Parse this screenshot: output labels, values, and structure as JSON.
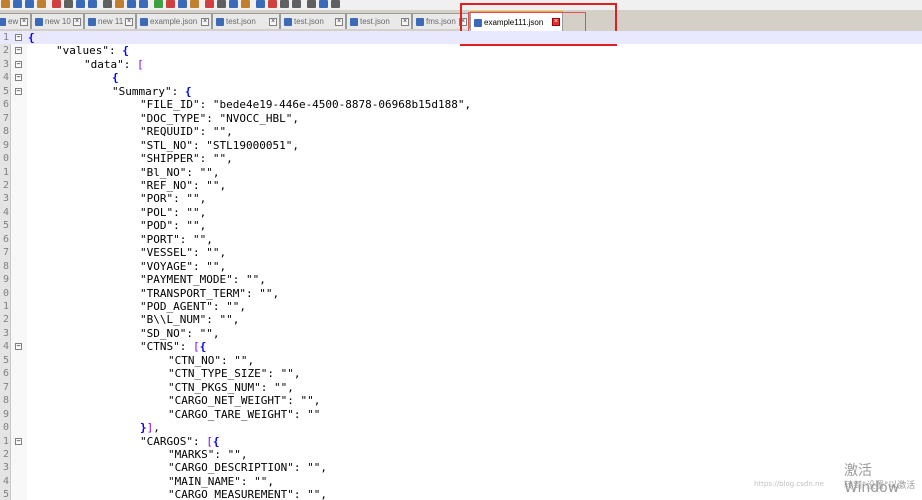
{
  "tabs": [
    {
      "label": "ew 9",
      "active": false
    },
    {
      "label": "new 10",
      "active": false
    },
    {
      "label": "new 11",
      "active": false
    },
    {
      "label": "example.json",
      "active": false
    },
    {
      "label": "test.json",
      "active": false
    },
    {
      "label": "test.json",
      "active": false
    },
    {
      "label": "test.json",
      "active": false
    },
    {
      "label": "fms.json",
      "active": false
    },
    {
      "label": "example111.json",
      "active": true
    }
  ],
  "tab_close_glyph": "×",
  "lines": [
    {
      "n": "1",
      "fold": "-",
      "indent": 0,
      "text": "{",
      "current": true
    },
    {
      "n": "2",
      "fold": "-",
      "indent": 1,
      "text": "\"values\": {"
    },
    {
      "n": "3",
      "fold": "-",
      "indent": 2,
      "text": "\"data\": ["
    },
    {
      "n": "4",
      "fold": "-",
      "indent": 3,
      "text": "{"
    },
    {
      "n": "5",
      "fold": "-",
      "indent": 3,
      "text": "\"Summary\": {"
    },
    {
      "n": "6",
      "fold": "",
      "indent": 4,
      "text": "\"FILE_ID\": \"bede4e19-446e-4500-8878-06968b15d188\","
    },
    {
      "n": "7",
      "fold": "",
      "indent": 4,
      "text": "\"DOC_TYPE\": \"NVOCC_HBL\","
    },
    {
      "n": "8",
      "fold": "",
      "indent": 4,
      "text": "\"REQUUID\": \"\","
    },
    {
      "n": "9",
      "fold": "",
      "indent": 4,
      "text": "\"STL_NO\": \"STL19000051\","
    },
    {
      "n": "0",
      "fold": "",
      "indent": 4,
      "text": "\"SHIPPER\": \"\","
    },
    {
      "n": "1",
      "fold": "",
      "indent": 4,
      "text": "\"Bl_NO\": \"\","
    },
    {
      "n": "2",
      "fold": "",
      "indent": 4,
      "text": "\"REF_NO\": \"\","
    },
    {
      "n": "3",
      "fold": "",
      "indent": 4,
      "text": "\"POR\": \"\","
    },
    {
      "n": "4",
      "fold": "",
      "indent": 4,
      "text": "\"POL\": \"\","
    },
    {
      "n": "5",
      "fold": "",
      "indent": 4,
      "text": "\"POD\": \"\","
    },
    {
      "n": "6",
      "fold": "",
      "indent": 4,
      "text": "\"PORT\": \"\","
    },
    {
      "n": "7",
      "fold": "",
      "indent": 4,
      "text": "\"VESSEL\": \"\","
    },
    {
      "n": "8",
      "fold": "",
      "indent": 4,
      "text": "\"VOYAGE\": \"\","
    },
    {
      "n": "9",
      "fold": "",
      "indent": 4,
      "text": "\"PAYMENT_MODE\": \"\","
    },
    {
      "n": "0",
      "fold": "",
      "indent": 4,
      "text": "\"TRANSPORT_TERM\": \"\","
    },
    {
      "n": "1",
      "fold": "",
      "indent": 4,
      "text": "\"POD_AGENT\": \"\","
    },
    {
      "n": "2",
      "fold": "",
      "indent": 4,
      "text": "\"B\\\\L_NUM\": \"\","
    },
    {
      "n": "3",
      "fold": "",
      "indent": 4,
      "text": "\"SD_NO\": \"\","
    },
    {
      "n": "4",
      "fold": "-",
      "indent": 4,
      "text": "\"CTNS\": [{"
    },
    {
      "n": "5",
      "fold": "",
      "indent": 5,
      "text": "\"CTN_NO\": \"\","
    },
    {
      "n": "6",
      "fold": "",
      "indent": 5,
      "text": "\"CTN_TYPE_SIZE\": \"\","
    },
    {
      "n": "7",
      "fold": "",
      "indent": 5,
      "text": "\"CTN_PKGS_NUM\": \"\","
    },
    {
      "n": "8",
      "fold": "",
      "indent": 5,
      "text": "\"CARGO_NET_WEIGHT\": \"\","
    },
    {
      "n": "9",
      "fold": "",
      "indent": 5,
      "text": "\"CARGO_TARE_WEIGHT\": \"\""
    },
    {
      "n": "0",
      "fold": "",
      "indent": 4,
      "text": "}],"
    },
    {
      "n": "1",
      "fold": "-",
      "indent": 4,
      "text": "\"CARGOS\": [{"
    },
    {
      "n": "2",
      "fold": "",
      "indent": 5,
      "text": "\"MARKS\": \"\","
    },
    {
      "n": "3",
      "fold": "",
      "indent": 5,
      "text": "\"CARGO_DESCRIPTION\": \"\","
    },
    {
      "n": "4",
      "fold": "",
      "indent": 5,
      "text": "\"MAIN_NAME\": \"\","
    },
    {
      "n": "5",
      "fold": "",
      "indent": 5,
      "text": "\"CARGO_MEASUREMENT\": \"\","
    }
  ],
  "watermark": {
    "line1": "激活 Window",
    "line2": "转到\"设置\"以激活",
    "url": "https://blog.csdn.ne"
  },
  "colors": {
    "annotation": "#e02020",
    "active_tab_accent": "#f5a623",
    "bracket": "#8000ff",
    "brace": "#0000ff"
  }
}
